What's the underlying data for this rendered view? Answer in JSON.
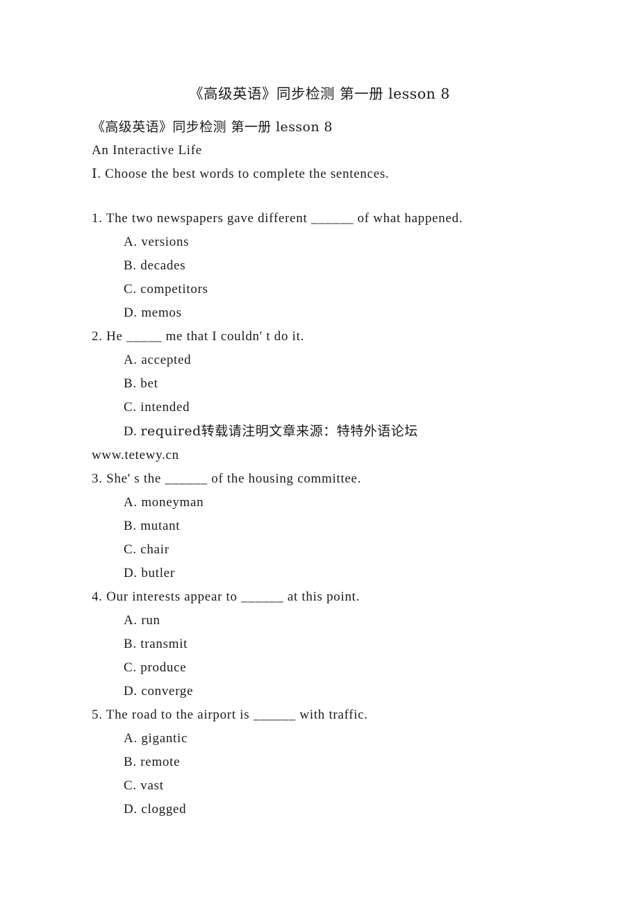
{
  "document": {
    "title": "《高级英语》同步检测 第一册 lesson 8",
    "heading_repeat": "《高级英语》同步检测 第一册 lesson 8",
    "lesson_title": "An Interactive Life",
    "section_instruction": "Ⅰ. Choose the best words to complete the sentences.",
    "watermark_note": "转载请注明文章来源：特特外语论坛",
    "watermark_url": "www.tetewy.cn",
    "blank": "______"
  },
  "questions": [
    {
      "number": "1.",
      "stem": "The two newspapers gave different ______ of what happened.",
      "options": [
        {
          "letter": "A.",
          "text": "versions"
        },
        {
          "letter": "B.",
          "text": "decades"
        },
        {
          "letter": "C.",
          "text": "competitors"
        },
        {
          "letter": "D.",
          "text": "memos"
        }
      ]
    },
    {
      "number": "2.",
      "stem": "He _____ me that I couldn' t do it.",
      "options": [
        {
          "letter": "A.",
          "text": "accepted"
        },
        {
          "letter": "B.",
          "text": "bet"
        },
        {
          "letter": "C.",
          "text": "intended"
        },
        {
          "letter": "D.",
          "text": "required转载请注明文章来源：特特外语论坛"
        }
      ]
    },
    {
      "number": "3.",
      "stem": "She' s the ______ of the housing committee.",
      "options": [
        {
          "letter": "A.",
          "text": "moneyman"
        },
        {
          "letter": "B.",
          "text": "mutant"
        },
        {
          "letter": "C.",
          "text": "chair"
        },
        {
          "letter": "D.",
          "text": "butler"
        }
      ]
    },
    {
      "number": "4.",
      "stem": "Our interests appear to ______ at this point.",
      "options": [
        {
          "letter": "A.",
          "text": "run"
        },
        {
          "letter": "B.",
          "text": "transmit"
        },
        {
          "letter": "C.",
          "text": "produce"
        },
        {
          "letter": "D.",
          "text": "converge"
        }
      ]
    },
    {
      "number": "5.",
      "stem": "The road to the airport is ______ with traffic.",
      "options": [
        {
          "letter": "A.",
          "text": "gigantic"
        },
        {
          "letter": "B.",
          "text": "remote"
        },
        {
          "letter": "C.",
          "text": "vast"
        },
        {
          "letter": "D.",
          "text": "clogged"
        }
      ]
    }
  ]
}
